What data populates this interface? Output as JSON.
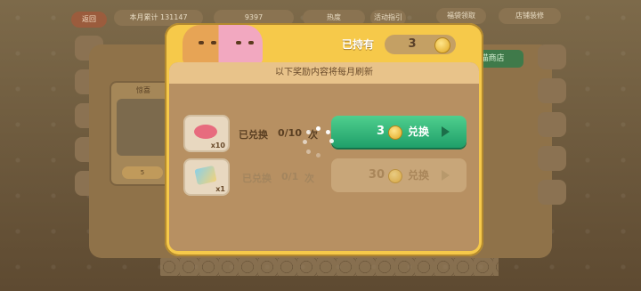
{
  "topbar": {
    "back_label": "返回",
    "stat1_label": "本月累计",
    "stat1_value": "131147",
    "coins_value": "9397",
    "stat3_label": "热度",
    "stat4_label": "活动指引",
    "stat5_label": "福袋领取",
    "stat6_label": "店铺装修"
  },
  "background": {
    "shop_label": "猫商店",
    "gift_title": "惊喜",
    "gift_price": "5"
  },
  "modal": {
    "owned_label": "已持有",
    "owned_value": "3",
    "header_text": "以下奖励内容将每月刷新",
    "rows": [
      {
        "icon": "fish-icon",
        "qty": "x10",
        "status": "已兑换",
        "count": "0/10",
        "unit": "次",
        "price": "3",
        "action": "兑换",
        "enabled": true
      },
      {
        "icon": "ticket-icon",
        "qty": "x1",
        "status": "已兑换",
        "count": "0/1",
        "unit": "次",
        "price": "30",
        "action": "兑换",
        "enabled": false
      }
    ]
  },
  "colors": {
    "accent_green": "#2fb877",
    "panel_yellow": "#f6c94a",
    "disabled": "#c8a679"
  }
}
